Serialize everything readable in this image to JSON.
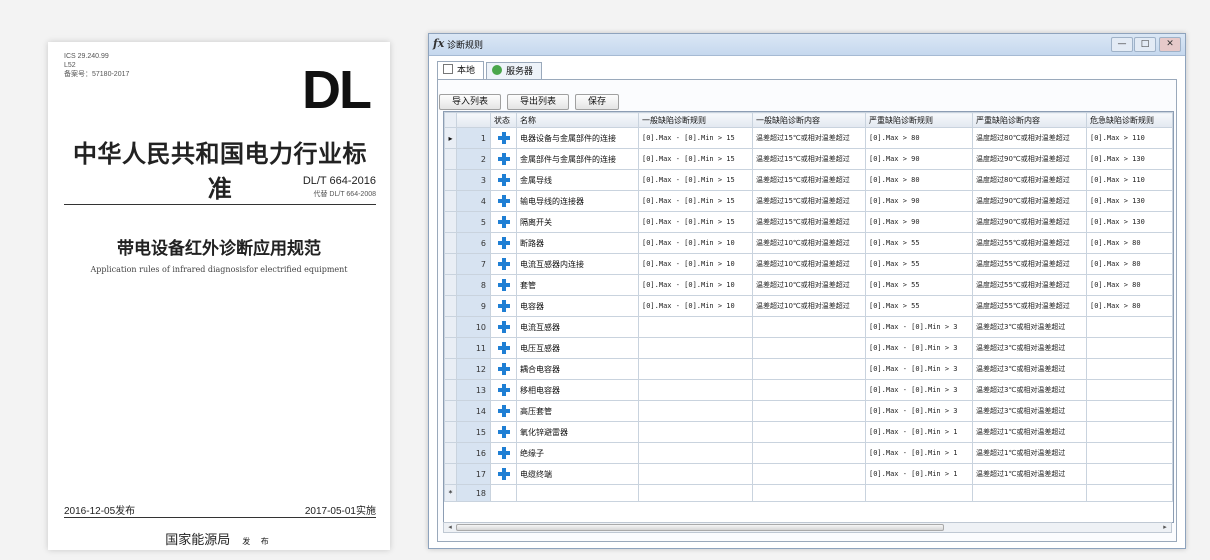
{
  "document": {
    "ics": "ICS 29.240.99",
    "ccs": "L52",
    "record_no": "备案号：57180-2017",
    "logo": "DL",
    "org": "中华人民共和国电力行业标准",
    "code": "DL/T 664-2016",
    "replaces": "代替 DL/T 664-2008",
    "title_zh": "带电设备红外诊断应用规范",
    "title_en": "Application rules of infrared diagnosisfor electrified equipment",
    "publish_date": "2016-12-05发布",
    "implement_date": "2017-05-01实施",
    "issuer": "国家能源局",
    "issuer_suffix": "发 布"
  },
  "window": {
    "title": "诊断规则",
    "icon_glyph": "fx",
    "min_glyph": "—",
    "max_glyph": "□",
    "close_glyph": "✕",
    "tabs": [
      {
        "label": "本地",
        "icon": "local-icon"
      },
      {
        "label": "服务器",
        "icon": "server-icon"
      }
    ],
    "toolbar": {
      "import_label": "导入列表",
      "export_label": "导出列表",
      "save_label": "保存"
    },
    "columns": [
      "状态",
      "名称",
      "一般缺陷诊断规则",
      "一般缺陷诊断内容",
      "严重缺陷诊断规则",
      "严重缺陷诊断内容",
      "危急缺陷诊断规则"
    ],
    "rows": [
      {
        "n": "1",
        "name": "电器设备与金属部件的连接",
        "r1": "[0].Max - [0].Min > 15",
        "c1": "温差超过15℃或相对温差超过",
        "r2": "[0].Max > 80",
        "c2": "温度超过80℃或相对温差超过",
        "r3": "[0].Max > 110"
      },
      {
        "n": "2",
        "name": "金属部件与金属部件的连接",
        "r1": "[0].Max - [0].Min > 15",
        "c1": "温差超过15℃或相对温差超过",
        "r2": "[0].Max > 90",
        "c2": "温度超过90℃或相对温差超过",
        "r3": "[0].Max > 130"
      },
      {
        "n": "3",
        "name": "金属导线",
        "r1": "[0].Max - [0].Min > 15",
        "c1": "温差超过15℃或相对温差超过",
        "r2": "[0].Max > 80",
        "c2": "温度超过80℃或相对温差超过",
        "r3": "[0].Max > 110"
      },
      {
        "n": "4",
        "name": "输电导线的连接器",
        "r1": "[0].Max - [0].Min > 15",
        "c1": "温差超过15℃或相对温差超过",
        "r2": "[0].Max > 90",
        "c2": "温度超过90℃或相对温差超过",
        "r3": "[0].Max > 130"
      },
      {
        "n": "5",
        "name": "隔离开关",
        "r1": "[0].Max - [0].Min > 15",
        "c1": "温差超过15℃或相对温差超过",
        "r2": "[0].Max > 90",
        "c2": "温度超过90℃或相对温差超过",
        "r3": "[0].Max > 130"
      },
      {
        "n": "6",
        "name": "断路器",
        "r1": "[0].Max - [0].Min > 10",
        "c1": "温差超过10℃或相对温差超过",
        "r2": "[0].Max > 55",
        "c2": "温度超过55℃或相对温差超过",
        "r3": "[0].Max > 80"
      },
      {
        "n": "7",
        "name": "电流互感器内连接",
        "r1": "[0].Max - [0].Min > 10",
        "c1": "温差超过10℃或相对温差超过",
        "r2": "[0].Max > 55",
        "c2": "温度超过55℃或相对温差超过",
        "r3": "[0].Max > 80"
      },
      {
        "n": "8",
        "name": "套管",
        "r1": "[0].Max - [0].Min > 10",
        "c1": "温差超过10℃或相对温差超过",
        "r2": "[0].Max > 55",
        "c2": "温度超过55℃或相对温差超过",
        "r3": "[0].Max > 80"
      },
      {
        "n": "9",
        "name": "电容器",
        "r1": "[0].Max - [0].Min > 10",
        "c1": "温差超过10℃或相对温差超过",
        "r2": "[0].Max > 55",
        "c2": "温度超过55℃或相对温差超过",
        "r3": "[0].Max > 80"
      },
      {
        "n": "10",
        "name": "电流互感器",
        "r1": "",
        "c1": "",
        "r2": "[0].Max - [0].Min > 3",
        "c2": "温差超过3℃或相对温差超过",
        "r3": ""
      },
      {
        "n": "11",
        "name": "电压互感器",
        "r1": "",
        "c1": "",
        "r2": "[0].Max - [0].Min > 3",
        "c2": "温差超过3℃或相对温差超过",
        "r3": ""
      },
      {
        "n": "12",
        "name": "耦合电容器",
        "r1": "",
        "c1": "",
        "r2": "[0].Max - [0].Min > 3",
        "c2": "温差超过3℃或相对温差超过",
        "r3": ""
      },
      {
        "n": "13",
        "name": "移相电容器",
        "r1": "",
        "c1": "",
        "r2": "[0].Max - [0].Min > 3",
        "c2": "温差超过3℃或相对温差超过",
        "r3": ""
      },
      {
        "n": "14",
        "name": "高压套管",
        "r1": "",
        "c1": "",
        "r2": "[0].Max - [0].Min > 3",
        "c2": "温差超过3℃或相对温差超过",
        "r3": ""
      },
      {
        "n": "15",
        "name": "氧化锌避雷器",
        "r1": "",
        "c1": "",
        "r2": "[0].Max - [0].Min > 1",
        "c2": "温差超过1℃或相对温差超过",
        "r3": ""
      },
      {
        "n": "16",
        "name": "绝缘子",
        "r1": "",
        "c1": "",
        "r2": "[0].Max - [0].Min > 1",
        "c2": "温差超过1℃或相对温差超过",
        "r3": ""
      },
      {
        "n": "17",
        "name": "电缆终端",
        "r1": "",
        "c1": "",
        "r2": "[0].Max - [0].Min > 1",
        "c2": "温差超过1℃或相对温差超过",
        "r3": ""
      }
    ],
    "new_row": {
      "marker": "*",
      "n": "18"
    },
    "current_row_marker": "▸",
    "scroll_left": "◂",
    "scroll_right": "▸"
  }
}
